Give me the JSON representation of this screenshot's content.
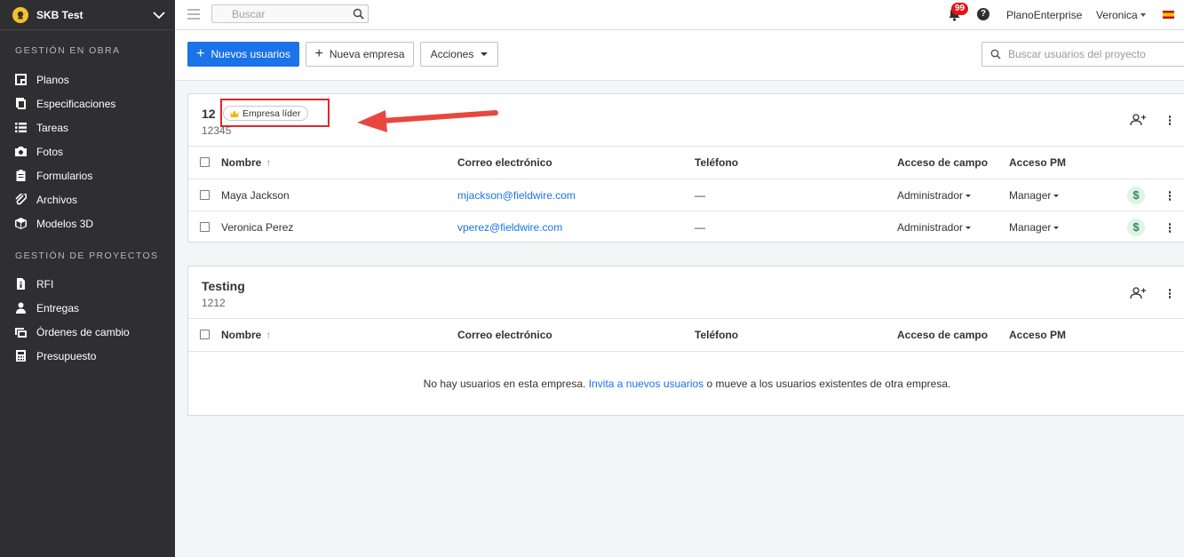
{
  "sidebar": {
    "project_name": "SKB Test",
    "sections": [
      {
        "title": "GESTIÓN EN OBRA",
        "items": [
          {
            "label": "Planos",
            "icon": "plans-icon"
          },
          {
            "label": "Especificaciones",
            "icon": "specifications-icon"
          },
          {
            "label": "Tareas",
            "icon": "tasks-icon"
          },
          {
            "label": "Fotos",
            "icon": "camera-icon"
          },
          {
            "label": "Formularios",
            "icon": "clipboard-icon"
          },
          {
            "label": "Archivos",
            "icon": "paperclip-icon"
          },
          {
            "label": "Modelos 3D",
            "icon": "cube-icon"
          }
        ]
      },
      {
        "title": "GESTIÓN DE PROYECTOS",
        "items": [
          {
            "label": "RFI",
            "icon": "rfi-document-icon"
          },
          {
            "label": "Entregas",
            "icon": "submittal-person-icon"
          },
          {
            "label": "Órdenes de cambio",
            "icon": "change-order-icon"
          },
          {
            "label": "Presupuesto",
            "icon": "calculator-icon"
          }
        ]
      }
    ]
  },
  "topbar": {
    "search_placeholder": "Buscar",
    "notifications_count": "99",
    "help_label": "?",
    "plan": "PlanoEnterprise",
    "user": "Veronica",
    "language_flag": "es"
  },
  "actions": {
    "new_users": "Nuevos usuarios",
    "new_company": "Nueva empresa",
    "actions_menu": "Acciones",
    "search_placeholder": "Buscar usuarios del proyecto"
  },
  "table_columns": {
    "name": "Nombre",
    "sort_indicator": "↑",
    "email": "Correo electrónico",
    "phone": "Teléfono",
    "field_access": "Acceso de campo",
    "pm_access": "Acceso PM"
  },
  "companies": [
    {
      "name": "12",
      "code": "12345",
      "badge": "Empresa líder",
      "users": [
        {
          "name": "Maya Jackson",
          "email": "mjackson@fieldwire.com",
          "phone": "—",
          "field_access": "Administrador",
          "pm_access": "Manager",
          "billing_symbol": "$"
        },
        {
          "name": "Veronica Perez",
          "email": "vperez@fieldwire.com",
          "phone": "—",
          "field_access": "Administrador",
          "pm_access": "Manager",
          "billing_symbol": "$"
        }
      ]
    },
    {
      "name": "Testing",
      "code": "1212",
      "empty_message": {
        "before": "No hay usuarios en esta empresa. ",
        "link": "Invita a nuevos usuarios",
        "after": " o mueve a los usuarios existentes de otra empresa."
      }
    }
  ],
  "colors": {
    "sidebar_bg": "#2f2f31",
    "primary": "#1a73e8",
    "badge_red": "#e4151b",
    "annotation_red": "#e0262b",
    "billing_green": "#2e8b57"
  }
}
